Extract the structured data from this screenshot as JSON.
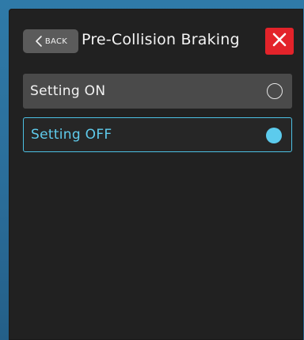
{
  "header": {
    "back_label": "BACK",
    "title": "Pre-Collision Braking",
    "close_icon": "close-x-icon"
  },
  "options": [
    {
      "label": "Setting ON",
      "selected": false
    },
    {
      "label": "Setting OFF",
      "selected": true
    }
  ],
  "colors": {
    "frame": "#2a6f9c",
    "background": "#212121",
    "close_button": "#e3232a",
    "accent": "#4cc0e3",
    "option_unselected_bg": "#4a4a4a"
  }
}
